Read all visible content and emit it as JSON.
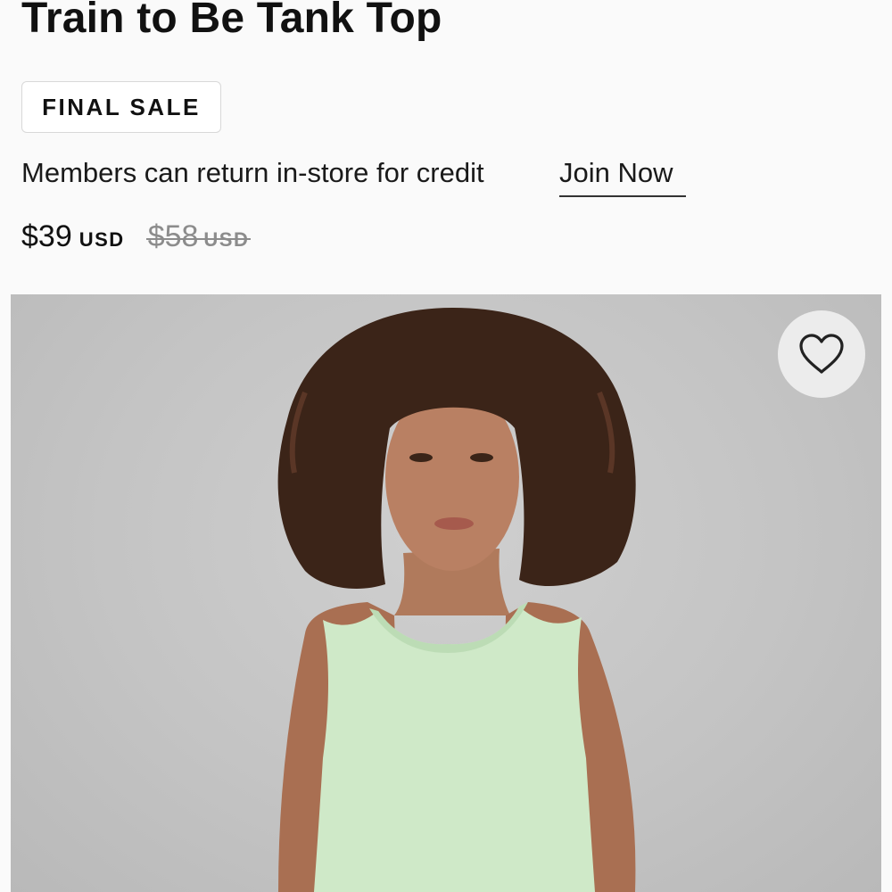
{
  "product": {
    "title": "Train to Be Tank Top",
    "badge": "FINAL SALE",
    "return_policy": "Members can return in-store for credit",
    "join_link": "Join Now",
    "price": {
      "current": "$39",
      "current_currency": "USD",
      "original": "$58",
      "original_currency": "USD"
    },
    "image": {
      "alt": "Woman with curly hair wearing a mint green tank top",
      "top_color": "#cde9c6",
      "background_color": "#c6c6c6"
    },
    "wishlist_icon": "heart-outline-icon"
  }
}
